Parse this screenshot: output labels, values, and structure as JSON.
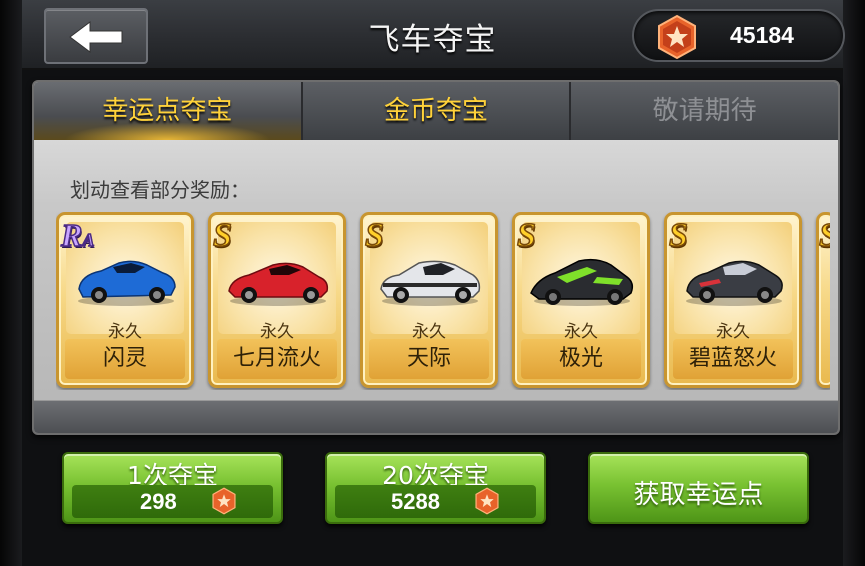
{
  "header": {
    "title": "飞车夺宝",
    "back_icon": "back-arrow-icon",
    "currency_icon": "lucky-star-coin-icon",
    "currency_amount": "45184"
  },
  "tabs": [
    {
      "label": "幸运点夺宝",
      "active": true
    },
    {
      "label": "金币夺宝",
      "active": false
    },
    {
      "label": "敬请期待",
      "active": false
    }
  ],
  "hint": "划动查看部分奖励：",
  "rewards": [
    {
      "grade": "RA",
      "duration": "永久",
      "name": "闪灵",
      "color": "#1e6bd6"
    },
    {
      "grade": "S",
      "duration": "永久",
      "name": "七月流火",
      "color": "#d8222b"
    },
    {
      "grade": "S",
      "duration": "永久",
      "name": "天际",
      "color": "#e4e6ea"
    },
    {
      "grade": "S",
      "duration": "永久",
      "name": "极光",
      "color": "#2a2c30"
    },
    {
      "grade": "S",
      "duration": "永久",
      "name": "碧蓝怒火",
      "color": "#3a3d44"
    }
  ],
  "actions": {
    "once": {
      "label": "1次夺宝",
      "cost": "298"
    },
    "twenty": {
      "label": "20次夺宝",
      "cost": "5288"
    },
    "get": {
      "label": "获取幸运点"
    }
  },
  "colors": {
    "accent_gold": "#ffd23a",
    "button_green": "#79c232",
    "card_gold": "#f7d989"
  }
}
